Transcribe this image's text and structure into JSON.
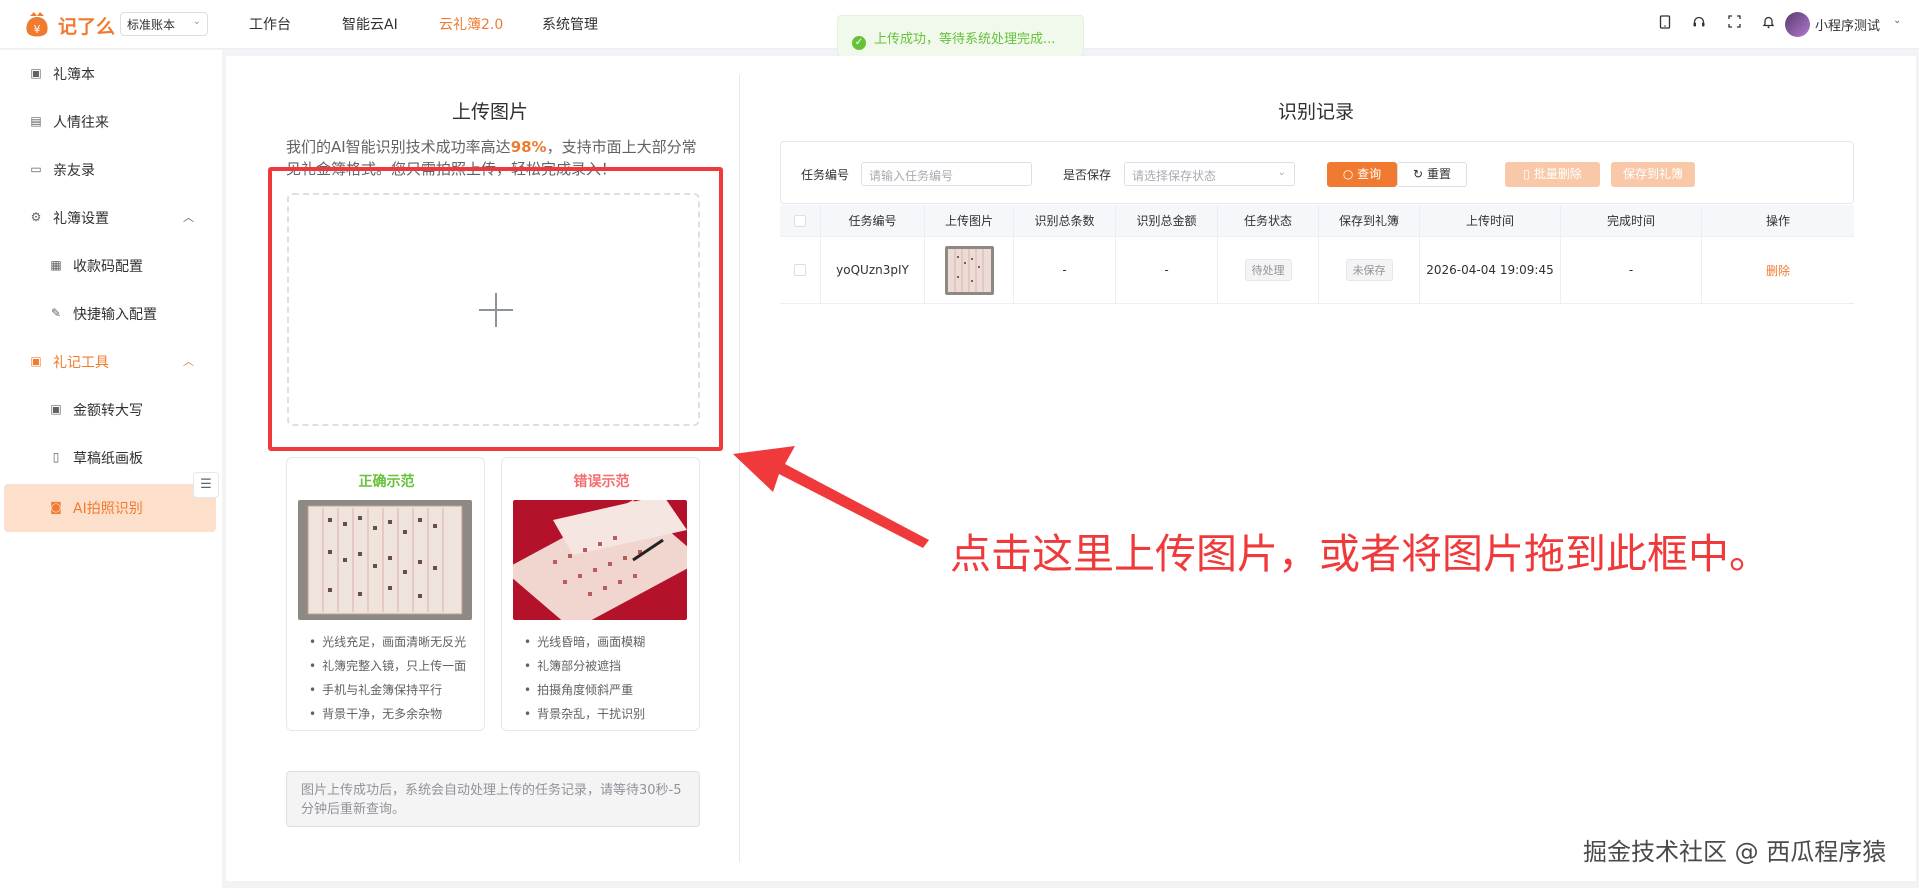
{
  "header": {
    "brand": "记了么",
    "ledger_select": "标准账本",
    "nav": [
      "工作台",
      "智能云AI",
      "云礼簿2.0",
      "系统管理"
    ],
    "active_nav": "云礼簿2.0",
    "toast": "上传成功，等待系统处理完成...",
    "username": "小程序测试",
    "icons": [
      "tablet-icon",
      "headset-icon",
      "fullscreen-icon",
      "bell-icon"
    ]
  },
  "sidebar": {
    "items": [
      {
        "label": "礼簿本",
        "icon": "book-icon"
      },
      {
        "label": "人情往来",
        "icon": "exchange-icon"
      },
      {
        "label": "亲友录",
        "icon": "folder-icon"
      },
      {
        "label": "礼簿设置",
        "icon": "gear-icon"
      },
      {
        "label": "收款码配置",
        "icon": "qrcode-icon"
      },
      {
        "label": "快捷输入配置",
        "icon": "edit-icon"
      },
      {
        "label": "礼记工具",
        "icon": "toolbox-icon"
      },
      {
        "label": "金额转大写",
        "icon": "convert-icon"
      },
      {
        "label": "草稿纸画板",
        "icon": "document-icon"
      },
      {
        "label": "AI拍照识别",
        "icon": "camera-icon"
      }
    ],
    "active": "AI拍照识别",
    "active_group": "礼记工具"
  },
  "upload": {
    "title": "上传图片",
    "desc_before": "我们的AI智能识别技术成功率高达",
    "desc_highlight": "98%",
    "desc_after": "，支持市面上大部分常见礼金簿格式。您只需拍照上传，轻松完成录入！",
    "tip": "图片上传成功后，系统会自动处理上传的任务记录，请等待30秒-5分钟后重新查询。"
  },
  "examples": {
    "good": {
      "title": "正确示范",
      "points": [
        "光线充足，画面清晰无反光",
        "礼簿完整入镜，只上传一面",
        "手机与礼金簿保持平行",
        "背景干净，无多余杂物"
      ]
    },
    "bad": {
      "title": "错误示范",
      "points": [
        "光线昏暗，画面模糊",
        "礼簿部分被遮挡",
        "拍摄角度倾斜严重",
        "背景杂乱，干扰识别"
      ]
    }
  },
  "records": {
    "title": "识别记录",
    "filters": {
      "task_no_label": "任务编号",
      "task_no_placeholder": "请输入任务编号",
      "saved_label": "是否保存",
      "saved_placeholder": "请选择保存状态"
    },
    "buttons": {
      "query": "查询",
      "reset": "重置",
      "batch_delete": "批量删除",
      "save_to_book": "保存到礼簿"
    },
    "columns": [
      "任务编号",
      "上传图片",
      "识别总条数",
      "识别总金额",
      "任务状态",
      "保存到礼簿",
      "上传时间",
      "完成时间",
      "操作"
    ],
    "rows": [
      {
        "task_no": "yoQUzn3pIY",
        "total_count": "-",
        "total_amount": "-",
        "status": "待处理",
        "saved": "未保存",
        "upload_time": "2026-04-04 19:09:45",
        "finish_time": "-",
        "action": "删除"
      }
    ]
  },
  "annotation": "点击这里上传图片，或者将图片拖到此框中。",
  "watermark": "掘金技术社区 @ 西瓜程序猿",
  "colors": {
    "accent": "#f07b30",
    "success": "#67c23a",
    "danger": "#f56c6c",
    "annotation_red": "#f0393a"
  }
}
